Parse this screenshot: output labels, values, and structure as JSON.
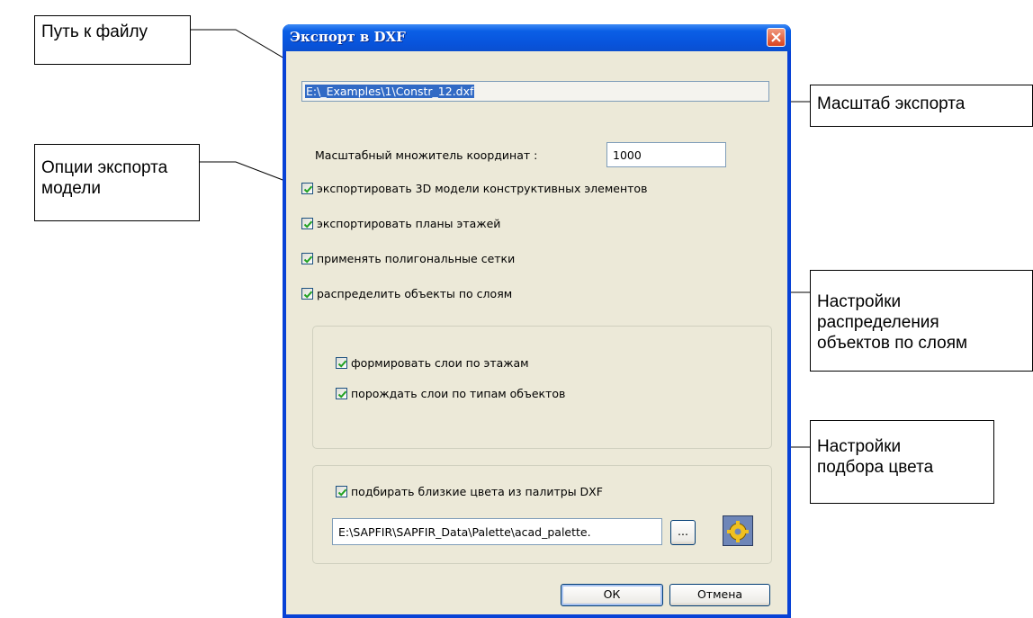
{
  "dialog": {
    "title": "Экспорт в DXF",
    "file_path": "E:\\_Examples\\1\\Constr_12.dxf",
    "scale_label": "Масштабный множитель координат :",
    "scale_value": "1000",
    "checkboxes": [
      {
        "label": "экспортировать 3D модели конструктивных элементов",
        "checked": true
      },
      {
        "label": "экспортировать планы этажей",
        "checked": true
      },
      {
        "label": "применять полигональные сетки",
        "checked": true
      },
      {
        "label": "распределить объекты по слоям",
        "checked": true
      }
    ],
    "layers_group": [
      {
        "label": "формировать слои по этажам",
        "checked": true
      },
      {
        "label": "порождать слои по типам объектов",
        "checked": true
      }
    ],
    "color_group": {
      "checkbox_label": "подбирать близкие цвета из палитры DXF",
      "checked": true,
      "palette_path": "E:\\SAPFIR\\SAPFIR_Data\\Palette\\acad_palette.",
      "browse_label": "...",
      "gear_icon": "palette-settings-icon"
    },
    "ok_label": "ОК",
    "cancel_label": "Отмена"
  },
  "callouts": {
    "file_path": "Путь к файлу",
    "scale": "Масштаб экспорта",
    "options": [
      "Опции экспорта",
      "модели"
    ],
    "layers": [
      "Настройки",
      "распределения",
      "объектов по слоям"
    ],
    "color": [
      "Настройки",
      "подбора цвета"
    ]
  },
  "colors": {
    "title_bar": "#0a5fe6",
    "dialog_bg": "#ece9d8",
    "close_button": "#d9431e",
    "selection": "#316ac5"
  }
}
